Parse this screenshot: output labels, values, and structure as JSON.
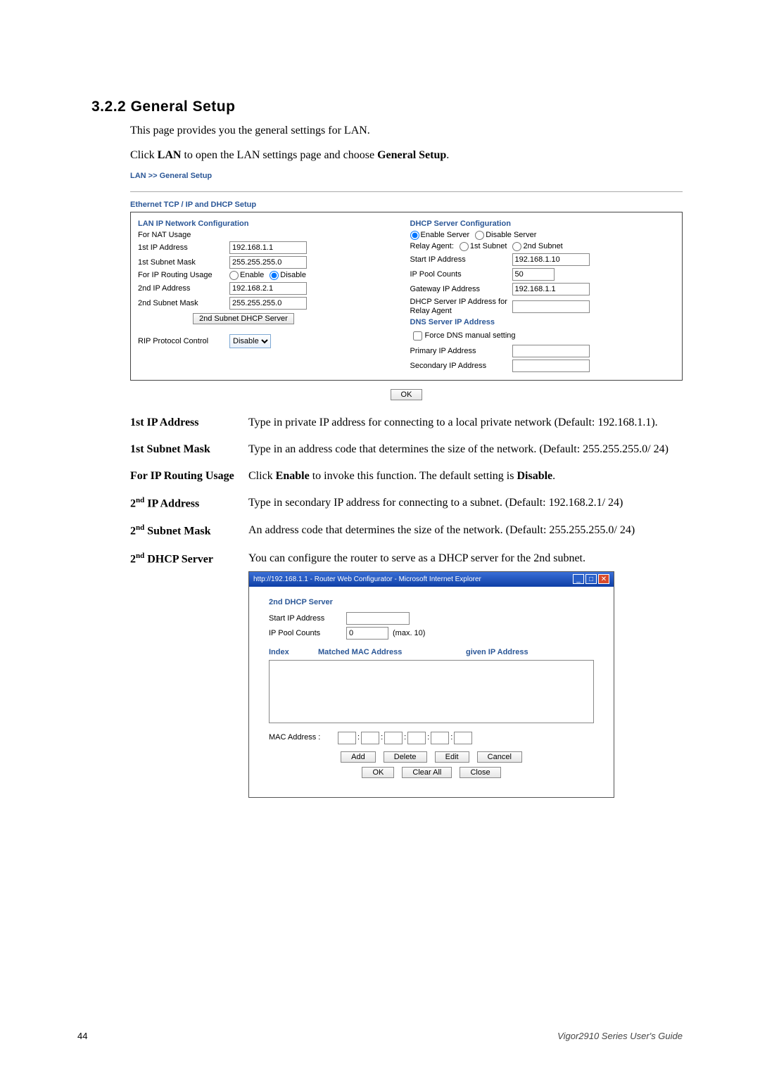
{
  "section": {
    "number": "3.2.2",
    "title": "General Setup"
  },
  "intro": {
    "line1": "This page provides you the general settings for LAN.",
    "line2_pre": "Click ",
    "line2_bold1": "LAN",
    "line2_mid": " to open the LAN settings page and choose ",
    "line2_bold2": "General Setup",
    "line2_post": "."
  },
  "panel": {
    "breadcrumb": "LAN >> General Setup",
    "section_title": "Ethernet TCP / IP and DHCP Setup",
    "lan_heading": "LAN IP Network Configuration",
    "nat_usage_label": "For NAT Usage",
    "ip1_label": "1st IP Address",
    "ip1_value": "192.168.1.1",
    "mask1_label": "1st Subnet Mask",
    "mask1_value": "255.255.255.0",
    "routing_label": "For IP Routing Usage",
    "routing_enable": "Enable",
    "routing_disable": "Disable",
    "ip2_label": "2nd IP Address",
    "ip2_value": "192.168.2.1",
    "mask2_label": "2nd Subnet Mask",
    "mask2_value": "255.255.255.0",
    "subnet_btn": "2nd Subnet DHCP Server",
    "rip_label": "RIP Protocol Control",
    "rip_value": "Disable",
    "dhcp_heading": "DHCP Server Configuration",
    "enable_server": "Enable Server",
    "disable_server": "Disable Server",
    "relay_label": "Relay Agent:",
    "relay_1": "1st Subnet",
    "relay_2": "2nd Subnet",
    "start_ip_label": "Start IP Address",
    "start_ip_value": "192.168.1.10",
    "pool_label": "IP Pool Counts",
    "pool_value": "50",
    "gateway_label": "Gateway IP Address",
    "gateway_value": "192.168.1.1",
    "dhcp_relay_ip_label": "DHCP Server IP Address for Relay Agent",
    "dns_heading": "DNS Server IP Address",
    "force_dns": "Force DNS manual setting",
    "primary_label": "Primary IP Address",
    "secondary_label": "Secondary IP Address",
    "ok_label": "OK"
  },
  "definitions": {
    "ip1": {
      "term": "1st IP Address",
      "desc": "Type in private IP address for connecting to a local private network (Default: 192.168.1.1)."
    },
    "mask1": {
      "term": "1st Subnet Mask",
      "desc": "Type in an address code that determines the size of the network. (Default: 255.255.255.0/ 24)"
    },
    "routing": {
      "term": "For IP Routing Usage",
      "desc_pre": "Click ",
      "desc_b1": "Enable",
      "desc_mid": " to invoke this function. The default setting is ",
      "desc_b2": "Disable",
      "desc_post": "."
    },
    "ip2": {
      "term_prefix": "2",
      "term_sup": "nd",
      "term_suffix": " IP Address",
      "desc": "Type in secondary IP address for connecting to a subnet. (Default: 192.168.2.1/ 24)"
    },
    "mask2": {
      "term_prefix": "2",
      "term_sup": "nd",
      "term_suffix": " Subnet Mask",
      "desc": "An address code that determines the size of the network. (Default: 255.255.255.0/ 24)"
    },
    "dhcp2": {
      "term_prefix": "2",
      "term_sup": "nd",
      "term_suffix": " DHCP Server",
      "desc": "You can configure the router to serve as a DHCP server for the 2nd subnet."
    }
  },
  "popup": {
    "title": "http://192.168.1.1 - Router Web Configurator - Microsoft Internet Explorer",
    "heading": "2nd DHCP Server",
    "start_ip": "Start IP Address",
    "pool_label": "IP Pool Counts",
    "pool_value": "0",
    "pool_hint": "(max. 10)",
    "col_index": "Index",
    "col_mac": "Matched MAC Address",
    "col_ip": "given IP Address",
    "mac_label": "MAC Address :",
    "btn_add": "Add",
    "btn_delete": "Delete",
    "btn_edit": "Edit",
    "btn_cancel": "Cancel",
    "btn_ok": "OK",
    "btn_clear": "Clear All",
    "btn_close": "Close"
  },
  "footer": {
    "page_num": "44",
    "guide": "Vigor2910  Series  User's Guide"
  }
}
